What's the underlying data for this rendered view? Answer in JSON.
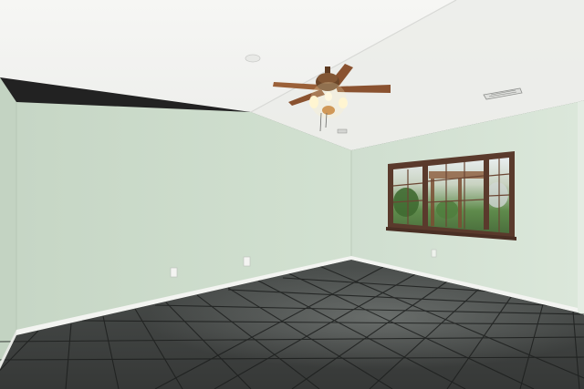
{
  "scene": {
    "subject": "empty-room-interior",
    "objects": [
      "ceiling-fan",
      "window",
      "hvac-vent",
      "smoke-detector",
      "electrical-outlet",
      "baseboard",
      "tile-floor"
    ]
  },
  "colors": {
    "ceiling": "#f1f1ef",
    "left_wall": "#d3e2d2",
    "back_wall": "#cfdfcf",
    "right_wall": "#d6e4d4",
    "floor": "#3e4140",
    "grout": "#1d1f1e",
    "window_frame": "#5a3a2c",
    "fan_blade": "#8a5230",
    "baseboard": "#f3f4f1"
  }
}
